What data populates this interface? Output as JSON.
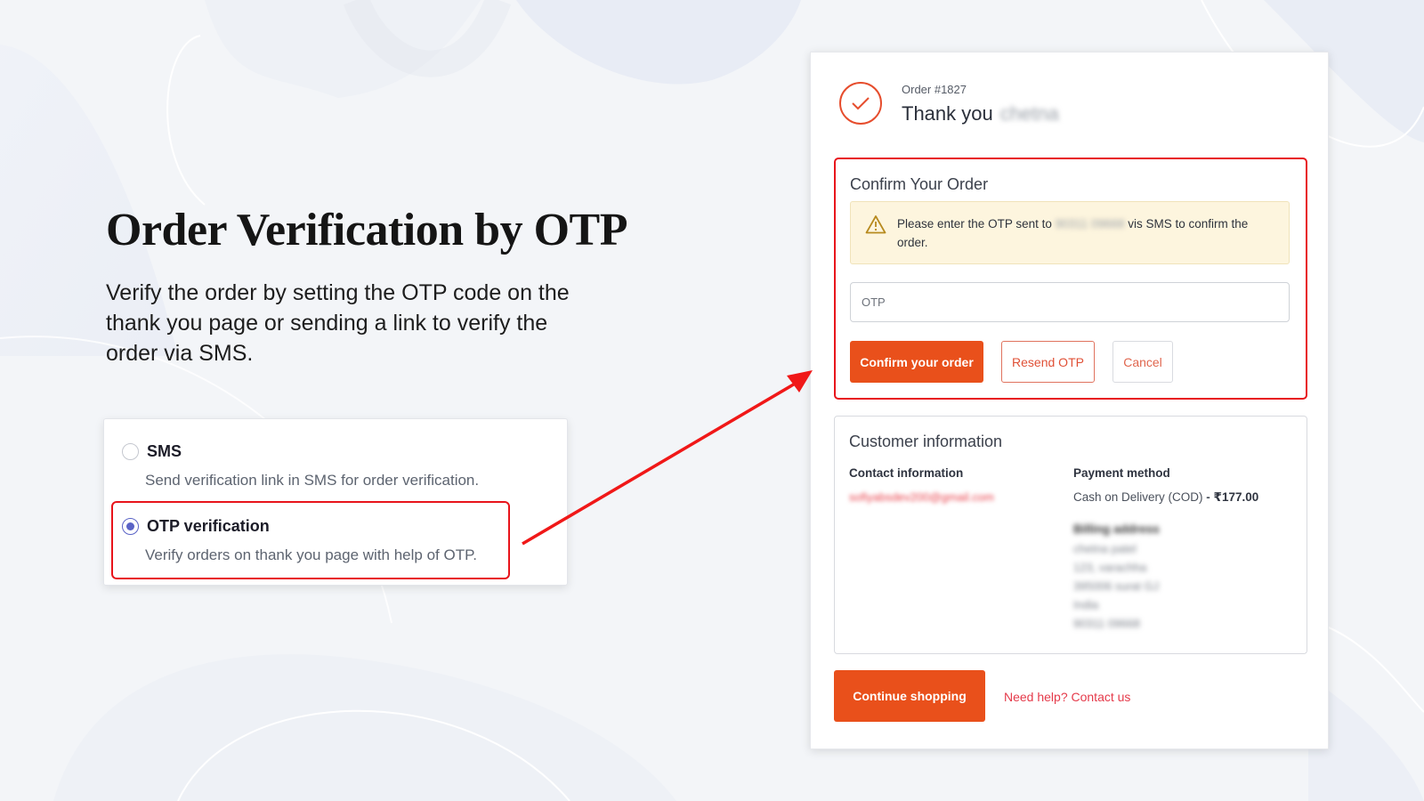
{
  "hero": {
    "title": "Order Verification by OTP",
    "description": "Verify the order by setting the OTP code on the thank you page or sending a link to verify the order via SMS."
  },
  "options": [
    {
      "label": "SMS",
      "description": "Send verification link in SMS for order verification.",
      "selected": false
    },
    {
      "label": "OTP verification",
      "description": "Verify orders on thank you page with help of OTP.",
      "selected": true
    }
  ],
  "order": {
    "number_label": "Order #1827",
    "thank_you": "Thank you",
    "customer_name_blurred": "chetna"
  },
  "confirm": {
    "title": "Confirm Your Order",
    "alert_prefix": "Please enter the OTP sent to",
    "alert_phone_blurred": "90311 09668",
    "alert_suffix": "vis SMS to confirm the order.",
    "otp_placeholder": "OTP",
    "otp_value": "",
    "confirm_button": "Confirm your order",
    "resend_button": "Resend OTP",
    "cancel_button": "Cancel"
  },
  "customer": {
    "title": "Customer information",
    "contact_heading": "Contact information",
    "contact_email_blurred": "sofiyabsdev200@gmail.com",
    "payment_heading": "Payment method",
    "payment_method": "Cash on Delivery (COD)",
    "payment_separator": " - ",
    "payment_amount": "₹177.00",
    "billing_heading_blurred": "Billing address",
    "billing_lines_blurred": [
      "chetna patel",
      "123, varachha",
      "395006 surat GJ",
      "India",
      "90311 09668"
    ]
  },
  "footer": {
    "continue_button": "Continue shopping",
    "help_link": "Need help? Contact us"
  },
  "colors": {
    "accent": "#e9501b",
    "highlight": "#e8141b",
    "radio_selected": "#5a63c6",
    "alert_bg": "#fdf5de"
  }
}
